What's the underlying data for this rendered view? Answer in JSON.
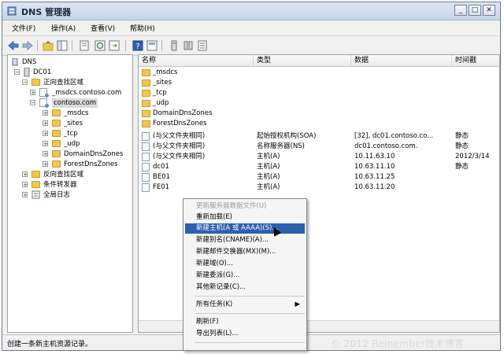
{
  "window": {
    "title": "DNS 管理器"
  },
  "menubar": [
    "文件(F)",
    "操作(A)",
    "查看(V)",
    "帮助(H)"
  ],
  "tree": {
    "root": "DNS",
    "server": "DC01",
    "forward_zones": "正向查找区域",
    "zone1": "_msdcs.contoso.com",
    "zone2": "contoso.com",
    "sub": [
      "_msdcs",
      "_sites",
      "_tcp",
      "_udp",
      "DomainDnsZones",
      "ForestDnsZones"
    ],
    "reverse_zones": "反向查找区域",
    "forwarders": "条件转发器",
    "global_logs": "全局日志"
  },
  "list": {
    "columns": [
      "名称",
      "类型",
      "数据",
      "时间戳"
    ],
    "rows": [
      {
        "name": "_msdcs",
        "type": "",
        "data": "",
        "time": ""
      },
      {
        "name": "_sites",
        "type": "",
        "data": "",
        "time": ""
      },
      {
        "name": "_tcp",
        "type": "",
        "data": "",
        "time": ""
      },
      {
        "name": "_udp",
        "type": "",
        "data": "",
        "time": ""
      },
      {
        "name": "DomainDnsZones",
        "type": "",
        "data": "",
        "time": ""
      },
      {
        "name": "ForestDnsZones",
        "type": "",
        "data": "",
        "time": ""
      },
      {
        "name": "(与父文件夹相同)",
        "type": "起始授权机构(SOA)",
        "data": "[32], dc01.contoso.co...",
        "time": "静态"
      },
      {
        "name": "(与父文件夹相同)",
        "type": "名称服务器(NS)",
        "data": "dc01.contoso.com.",
        "time": "静态"
      },
      {
        "name": "(与父文件夹相同)",
        "type": "主机(A)",
        "data": "10.11.63.10",
        "time": "2012/3/14"
      },
      {
        "name": "dc01",
        "type": "主机(A)",
        "data": "10.63.11.10",
        "time": "静态"
      },
      {
        "name": "BE01",
        "type": "主机(A)",
        "data": "10.63.11.25",
        "time": ""
      },
      {
        "name": "FE01",
        "type": "主机(A)",
        "data": "10.63.11.20",
        "time": ""
      }
    ]
  },
  "context_menu": {
    "items": [
      "更新服务器数据文件(U)",
      "重新加载(E)",
      "新建主机(A 或 AAAA)(S)...",
      "新建别名(CNAME)(A)...",
      "新建邮件交换器(MX)(M)...",
      "新建域(O)...",
      "新建委派(G)...",
      "其他新记录(C)...",
      "所有任务(K)",
      "刷新(F)",
      "导出列表(L)..."
    ]
  },
  "status": "创建一条新主机资源记录。",
  "watermark": "© 2012 Reinember技术博客"
}
